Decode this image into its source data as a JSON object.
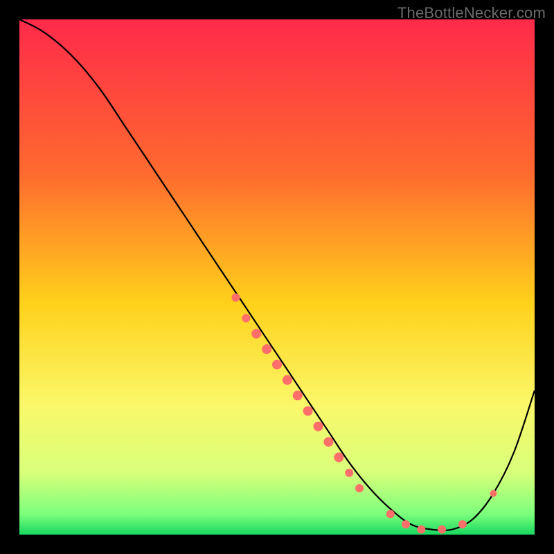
{
  "watermark": "TheBottleNecker.com",
  "chart_data": {
    "type": "line",
    "title": "",
    "xlabel": "",
    "ylabel": "",
    "xlim": [
      0,
      100
    ],
    "ylim": [
      0,
      100
    ],
    "gradient_stops": [
      {
        "offset": 0,
        "color": "#ff2a4a"
      },
      {
        "offset": 30,
        "color": "#ff6a2f"
      },
      {
        "offset": 55,
        "color": "#ffd11a"
      },
      {
        "offset": 75,
        "color": "#faf86a"
      },
      {
        "offset": 88,
        "color": "#d8ff7a"
      },
      {
        "offset": 96,
        "color": "#7cff7c"
      },
      {
        "offset": 100,
        "color": "#18d860"
      }
    ],
    "series": [
      {
        "name": "bottleneck-curve",
        "x": [
          0,
          4,
          8,
          12,
          16,
          20,
          24,
          28,
          32,
          36,
          40,
          44,
          48,
          52,
          56,
          60,
          64,
          68,
          72,
          76,
          80,
          84,
          88,
          92,
          96,
          100
        ],
        "y": [
          100,
          98,
          95,
          91,
          86,
          80,
          74,
          68,
          62,
          56,
          50,
          44,
          38,
          32,
          26,
          20,
          14,
          9,
          5,
          2,
          1,
          1,
          3,
          8,
          16,
          28
        ]
      }
    ],
    "markers": {
      "name": "highlight-points",
      "color": "#ff6f6a",
      "points": [
        {
          "x": 42,
          "y": 46,
          "r": 6
        },
        {
          "x": 44,
          "y": 42,
          "r": 6
        },
        {
          "x": 46,
          "y": 39,
          "r": 7
        },
        {
          "x": 48,
          "y": 36,
          "r": 7
        },
        {
          "x": 50,
          "y": 33,
          "r": 7
        },
        {
          "x": 52,
          "y": 30,
          "r": 7
        },
        {
          "x": 54,
          "y": 27,
          "r": 7
        },
        {
          "x": 56,
          "y": 24,
          "r": 7
        },
        {
          "x": 58,
          "y": 21,
          "r": 7
        },
        {
          "x": 60,
          "y": 18,
          "r": 7
        },
        {
          "x": 62,
          "y": 15,
          "r": 7
        },
        {
          "x": 64,
          "y": 12,
          "r": 6
        },
        {
          "x": 66,
          "y": 9,
          "r": 6
        },
        {
          "x": 72,
          "y": 4,
          "r": 6
        },
        {
          "x": 75,
          "y": 2,
          "r": 6
        },
        {
          "x": 78,
          "y": 1,
          "r": 6
        },
        {
          "x": 82,
          "y": 1,
          "r": 6
        },
        {
          "x": 86,
          "y": 2,
          "r": 6
        },
        {
          "x": 92,
          "y": 8,
          "r": 5
        }
      ]
    }
  }
}
